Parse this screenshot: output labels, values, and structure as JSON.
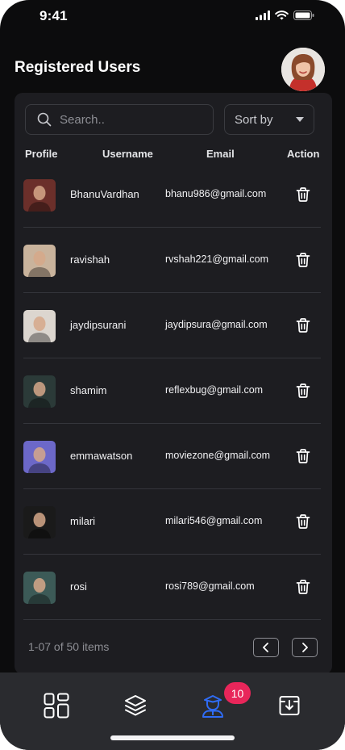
{
  "status_bar": {
    "time": "9:41"
  },
  "header": {
    "title": "Registered Users",
    "avatar_icon": "user-avatar"
  },
  "search": {
    "placeholder": "Search.."
  },
  "sort": {
    "label": "Sort by"
  },
  "columns": {
    "profile": "Profile",
    "username": "Username",
    "email": "Email",
    "action": "Action"
  },
  "users": [
    {
      "username": "BhanuVardhan",
      "email": "bhanu986@gmail.com",
      "avatar_color": "#6b2f2a"
    },
    {
      "username": "ravishah",
      "email": "rvshah221@gmail.com",
      "avatar_color": "#c9b39c"
    },
    {
      "username": "jaydipsurani",
      "email": "jaydipsura@gmail.com",
      "avatar_color": "#dcd6cf"
    },
    {
      "username": "shamim",
      "email": "reflexbug@gmail.com",
      "avatar_color": "#2b3a38"
    },
    {
      "username": "emmawatson",
      "email": "moviezone@gmail.com",
      "avatar_color": "#6c68c8"
    },
    {
      "username": "milari",
      "email": "milari546@gmail.com",
      "avatar_color": "#1a1a1a"
    },
    {
      "username": "rosi",
      "email": "rosi789@gmail.com",
      "avatar_color": "#3c5a57"
    }
  ],
  "pagination": {
    "summary": "1-07 of 50 items"
  },
  "bottom_nav": {
    "badge_count": "10",
    "active_color": "#2f6cf6",
    "badge_color": "#e8265a"
  }
}
